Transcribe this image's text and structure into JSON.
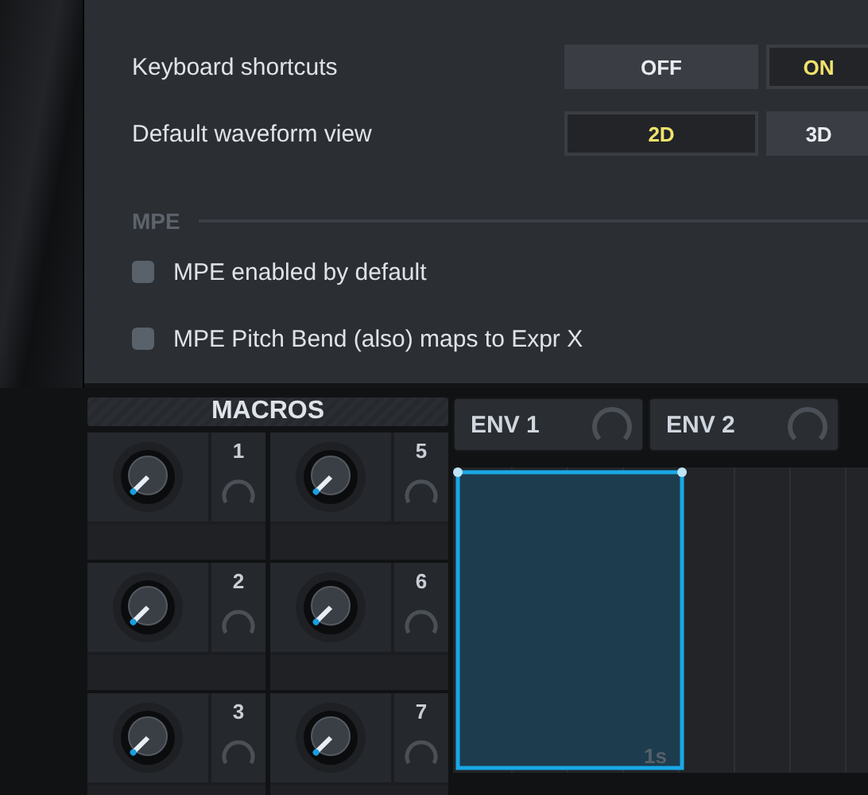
{
  "settings": {
    "rows": [
      {
        "label": "Keyboard shortcuts",
        "options": [
          {
            "label": "OFF",
            "selected": false
          },
          {
            "label": "ON",
            "selected": true
          }
        ]
      },
      {
        "label": "Default waveform view",
        "options": [
          {
            "label": "2D",
            "selected": true
          },
          {
            "label": "3D",
            "selected": false
          }
        ]
      }
    ],
    "section": "MPE",
    "checkboxes": [
      {
        "label": "MPE enabled by default",
        "checked": false
      },
      {
        "label": "MPE Pitch Bend (also) maps to Expr X",
        "checked": false
      }
    ]
  },
  "macros": {
    "title": "MACROS",
    "items": [
      {
        "number": "1"
      },
      {
        "number": "5"
      },
      {
        "number": "2"
      },
      {
        "number": "6"
      },
      {
        "number": "3"
      },
      {
        "number": "7"
      }
    ]
  },
  "envelopes": {
    "tabs": [
      {
        "label": "ENV 1"
      },
      {
        "label": "ENV 2"
      }
    ],
    "graph": {
      "time_label": "1s"
    }
  }
}
